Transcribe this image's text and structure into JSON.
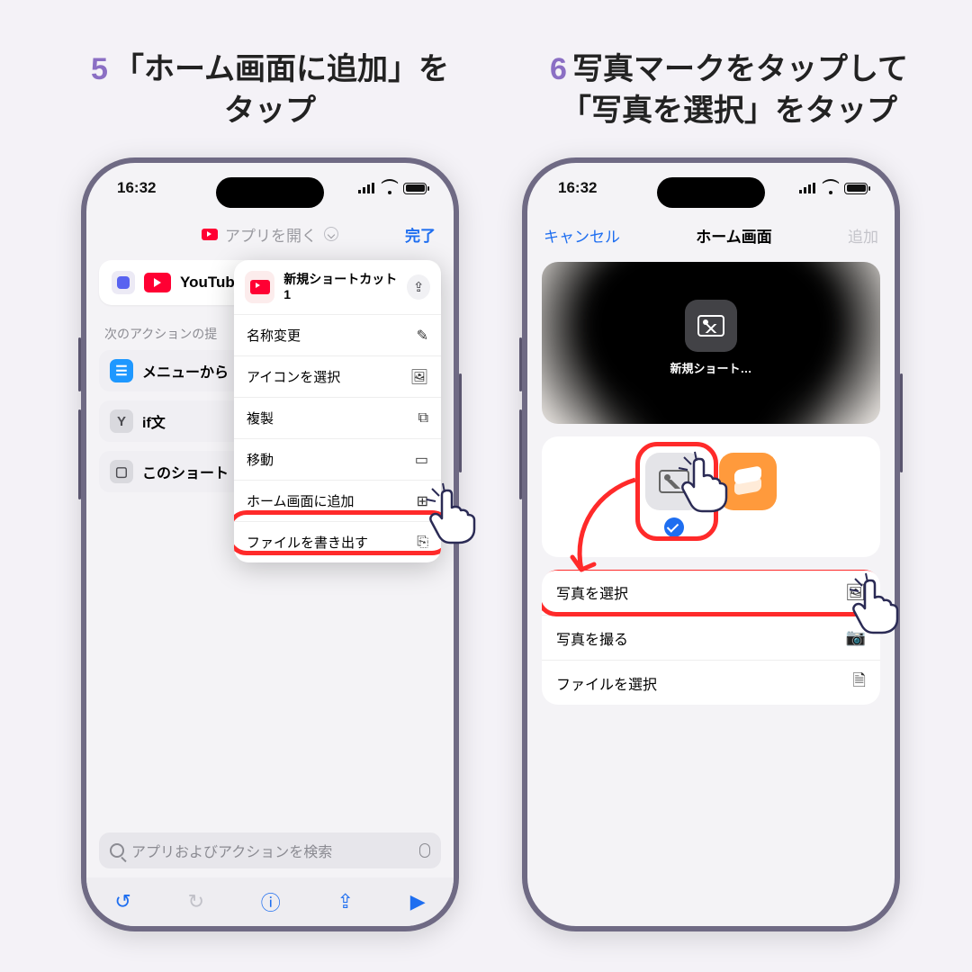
{
  "captions": {
    "left_num": "5",
    "left_text1": "「ホーム画面に追加」を",
    "left_text2": "タップ",
    "right_num": "6",
    "right_text1": "写真マークをタップして",
    "right_text2": "「写真を選択」をタップ"
  },
  "status": {
    "time": "16:32"
  },
  "left": {
    "header_app_open": "アプリを開く",
    "done": "完了",
    "youtube_card": "YouTub",
    "section_label": "次のアクションの提",
    "chips": {
      "menu": "メニューから",
      "if": "if文",
      "shortcut": "このショート"
    },
    "popup": {
      "title": "新規ショートカット 1",
      "rename": "名称変更",
      "choose_icon": "アイコンを選択",
      "duplicate": "複製",
      "move": "移動",
      "add_home": "ホーム画面に追加",
      "export": "ファイルを書き出す"
    },
    "search_placeholder": "アプリおよびアクションを検索"
  },
  "right": {
    "cancel": "キャンセル",
    "title": "ホーム画面",
    "add": "追加",
    "preview_label": "新規ショート…",
    "choose_photo": "写真を選択",
    "take_photo": "写真を撮る",
    "choose_file": "ファイルを選択"
  }
}
